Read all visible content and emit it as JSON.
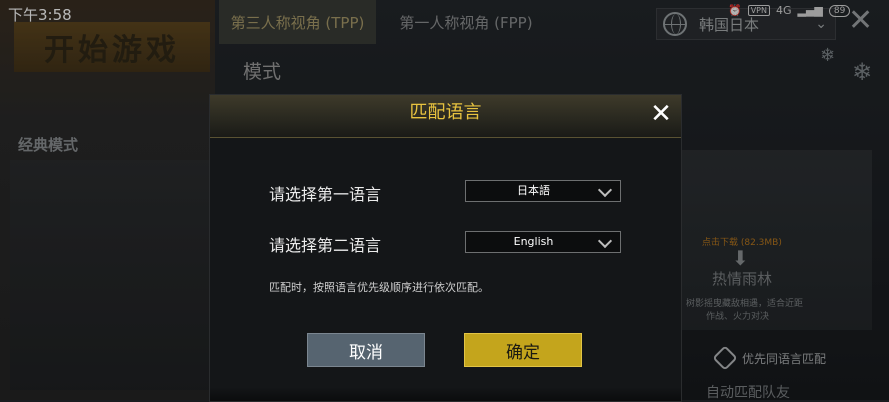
{
  "status_bar": {
    "time": "下午3:58",
    "vpn": "VPN",
    "network": "4G",
    "battery": "89"
  },
  "background": {
    "start_button": "开始游戏",
    "classic_mode": "经典模式",
    "tabs": {
      "tpp": "第三人称视角 (TPP)",
      "fpp": "第一人称视角 (FPP)"
    },
    "mode_label": "模式",
    "region": "韩国日本",
    "map": {
      "download": "点击下载 (82.3MB)",
      "name": "热情雨林",
      "desc_line1": "树影摇曳藏敌相遇，适合近距",
      "desc_line2": "作战、火力对决"
    },
    "prefer_language_match": "优先同语言匹配",
    "auto_match": "自动匹配队友"
  },
  "dialog": {
    "title": "匹配语言",
    "first_language_label": "请选择第一语言",
    "first_language_value": "日本語",
    "second_language_label": "请选择第二语言",
    "second_language_value": "English",
    "hint": "匹配时，按照语言优先级顺序进行依次匹配。",
    "cancel": "取消",
    "confirm": "确定"
  },
  "colors": {
    "title_gold": "#e8c33f",
    "confirm_bg": "#c4a51c",
    "cancel_bg": "#566470"
  }
}
